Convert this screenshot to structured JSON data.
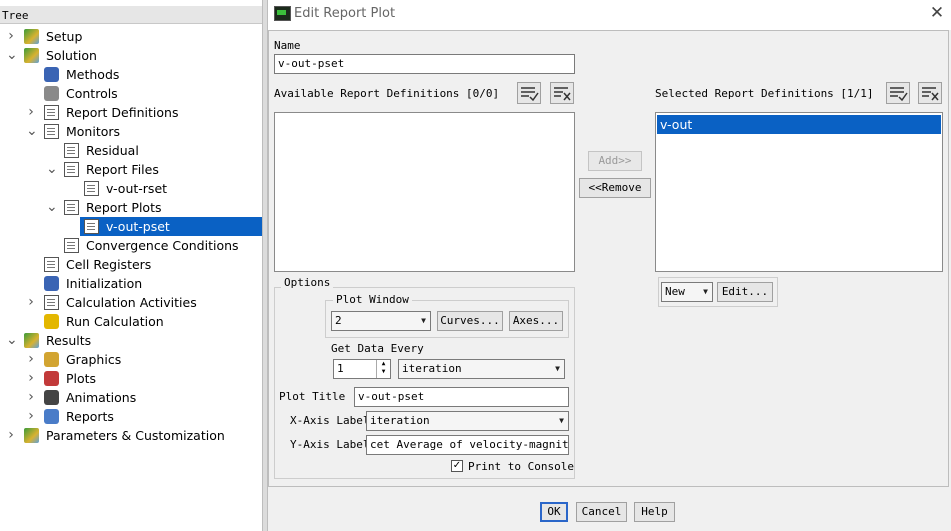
{
  "tree": {
    "header": "Tree",
    "items": [
      {
        "label": "Setup",
        "icon": "setup-icon",
        "expander": ">"
      },
      {
        "label": "Solution",
        "icon": "solution-icon",
        "expander": "v"
      },
      {
        "label": "Methods",
        "icon": "methods-icon",
        "expander": ""
      },
      {
        "label": "Controls",
        "icon": "controls-icon",
        "expander": ""
      },
      {
        "label": "Report Definitions",
        "icon": "report-definitions-icon",
        "expander": ">"
      },
      {
        "label": "Monitors",
        "icon": "monitors-icon",
        "expander": "v"
      },
      {
        "label": "Residual",
        "icon": "residual-icon",
        "expander": ""
      },
      {
        "label": "Report Files",
        "icon": "report-files-icon",
        "expander": "v"
      },
      {
        "label": "v-out-rset",
        "icon": "report-file-icon",
        "expander": ""
      },
      {
        "label": "Report Plots",
        "icon": "report-plots-icon",
        "expander": "v"
      },
      {
        "label": "v-out-pset",
        "icon": "report-plot-icon",
        "expander": ""
      },
      {
        "label": "Convergence Conditions",
        "icon": "convergence-conditions-icon",
        "expander": ""
      },
      {
        "label": "Cell Registers",
        "icon": "cell-registers-icon",
        "expander": ""
      },
      {
        "label": "Initialization",
        "icon": "initialization-icon",
        "expander": ""
      },
      {
        "label": "Calculation Activities",
        "icon": "calculation-activities-icon",
        "expander": ">"
      },
      {
        "label": "Run Calculation",
        "icon": "run-calculation-icon",
        "expander": ""
      },
      {
        "label": "Results",
        "icon": "results-icon",
        "expander": "v"
      },
      {
        "label": "Graphics",
        "icon": "graphics-icon",
        "expander": ">"
      },
      {
        "label": "Plots",
        "icon": "plots-icon",
        "expander": ">"
      },
      {
        "label": "Animations",
        "icon": "animations-icon",
        "expander": ">"
      },
      {
        "label": "Reports",
        "icon": "reports-icon",
        "expander": ">"
      },
      {
        "label": "Parameters & Customization",
        "icon": "parameters-icon",
        "expander": ">"
      }
    ]
  },
  "dialog": {
    "title": "Edit Report Plot",
    "close_icon": "close-icon",
    "name_label": "Name",
    "name_value": "v-out-pset",
    "available_label": "Available Report Definitions [0/0]",
    "selected_label": "Selected Report Definitions [1/1]",
    "available_items": [],
    "selected_items": [
      "v-out"
    ],
    "add_button": "Add>>",
    "remove_button": "<<Remove",
    "new_button": "New",
    "edit_button": "Edit...",
    "options_label": "Options",
    "plot_window_label": "Plot Window",
    "plot_window_value": "2",
    "curves_button": "Curves...",
    "axes_button": "Axes...",
    "get_data_every_label": "Get Data Every",
    "get_data_every_value": "1",
    "get_data_every_unit": "iteration",
    "plot_title_label": "Plot Title",
    "plot_title_value": "v-out-pset",
    "x_axis_label_label": "X-Axis Label",
    "x_axis_label_value": "iteration",
    "y_axis_label_label": "Y-Axis Label",
    "y_axis_label_value": "cet Average of velocity-magnitude",
    "print_to_console_label": "Print to Console",
    "print_to_console_checked": true,
    "ok_button": "OK",
    "cancel_button": "Cancel",
    "help_button": "Help"
  },
  "colors": {
    "selection": "#0a61c4",
    "background": "#f0f0f0"
  }
}
